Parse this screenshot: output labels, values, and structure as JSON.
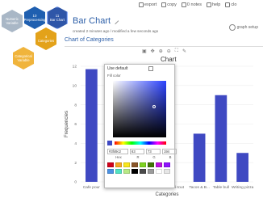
{
  "toolbar": [
    {
      "name": "export",
      "label": "export"
    },
    {
      "name": "copy",
      "label": "copy"
    },
    {
      "name": "notes",
      "label": "0 notes"
    },
    {
      "name": "help",
      "label": "help"
    },
    {
      "name": "close",
      "label": "clo"
    }
  ],
  "workflow": {
    "numeric": {
      "label": "Numeric Variable"
    },
    "preprocessing": {
      "num": "10",
      "label": "Preprocessing"
    },
    "barchart": {
      "num": "11",
      "label": "Bar Chart"
    },
    "categories": {
      "num": "4",
      "label": "Categories"
    },
    "categorical": {
      "label": "Categorical Variable"
    }
  },
  "header": {
    "title": "Bar Chart",
    "meta": "created 2 minutes ago / modified a few seconds ago",
    "graph_setup": "graph setup",
    "section": "Chart of Categories"
  },
  "chart_data": {
    "type": "bar",
    "title": "Chart",
    "ylabel": "Frequencies",
    "xlabel": "Categories",
    "ylim": [
      0,
      12
    ],
    "yticks": [
      0,
      2,
      4,
      6,
      8,
      10,
      12
    ],
    "categories": [
      "Cafe pour",
      "",
      "",
      "",
      "Fri-tout",
      "Tacos & B...",
      "Table bull",
      "Writing pizza"
    ],
    "values": [
      11.7,
      0,
      0,
      0,
      0,
      5,
      9,
      3
    ],
    "bar_color": "#3f49c2"
  },
  "picker": {
    "use_default": "Use default",
    "fill_color": "Fill color",
    "hex": "#3f49c2",
    "r": "63",
    "g": "73",
    "b": "194",
    "label_hex": "Hex",
    "label_r": "R",
    "label_g": "G",
    "label_b": "B",
    "swatches": [
      "#d0021b",
      "#f5a623",
      "#f8e71c",
      "#8b572a",
      "#7ed321",
      "#417505",
      "#bd10e0",
      "#9013fe",
      "#4a90e2",
      "#50e3c2",
      "#b8e986",
      "#000000",
      "#4a4a4a",
      "#9b9b9b",
      "#ffffff",
      "#e6e6e6"
    ]
  }
}
